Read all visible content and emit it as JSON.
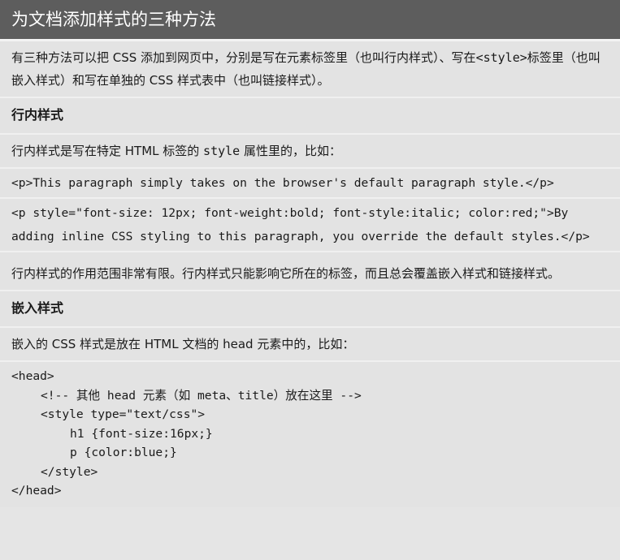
{
  "title": "为文档添加样式的三种方法",
  "intro": {
    "before": "有三种方法可以把 CSS 添加到网页中，分别是写在元素标签里（也叫行内样式）、写在",
    "code": "<style>",
    "after": "标签里（也叫嵌入样式）和写在单独的 CSS 样式表中（也叫链接样式）。"
  },
  "inline_section": {
    "heading": "行内样式",
    "desc_before": "行内样式是写在特定 HTML 标签的 ",
    "desc_code": "style",
    "desc_after": " 属性里的，比如：",
    "code_line1": "<p>This paragraph simply takes on the browser's default paragraph style.</p>",
    "code_line2a": "<p style=\"font-size: 12px; font-weight:bold; font-style:italic; color:red;\">By",
    "code_line2b": "adding inline CSS styling to this paragraph, you override the default styles.</p>",
    "note": "行内样式的作用范围非常有限。行内样式只能影响它所在的标签，而且总会覆盖嵌入样式和链接样式。"
  },
  "embedded_section": {
    "heading": "嵌入样式",
    "desc": "嵌入的 CSS 样式是放在 HTML 文档的 head 元素中的，比如：",
    "code": {
      "l1": "<head>",
      "l2": "<!-- 其他 head 元素（如 meta、title）放在这里 -->",
      "l3": "<style type=\"text/css\">",
      "l4": "h1 {font-size:16px;}",
      "l5": "p {color:blue;}",
      "l6": "</style>",
      "l7": "</head>"
    }
  }
}
